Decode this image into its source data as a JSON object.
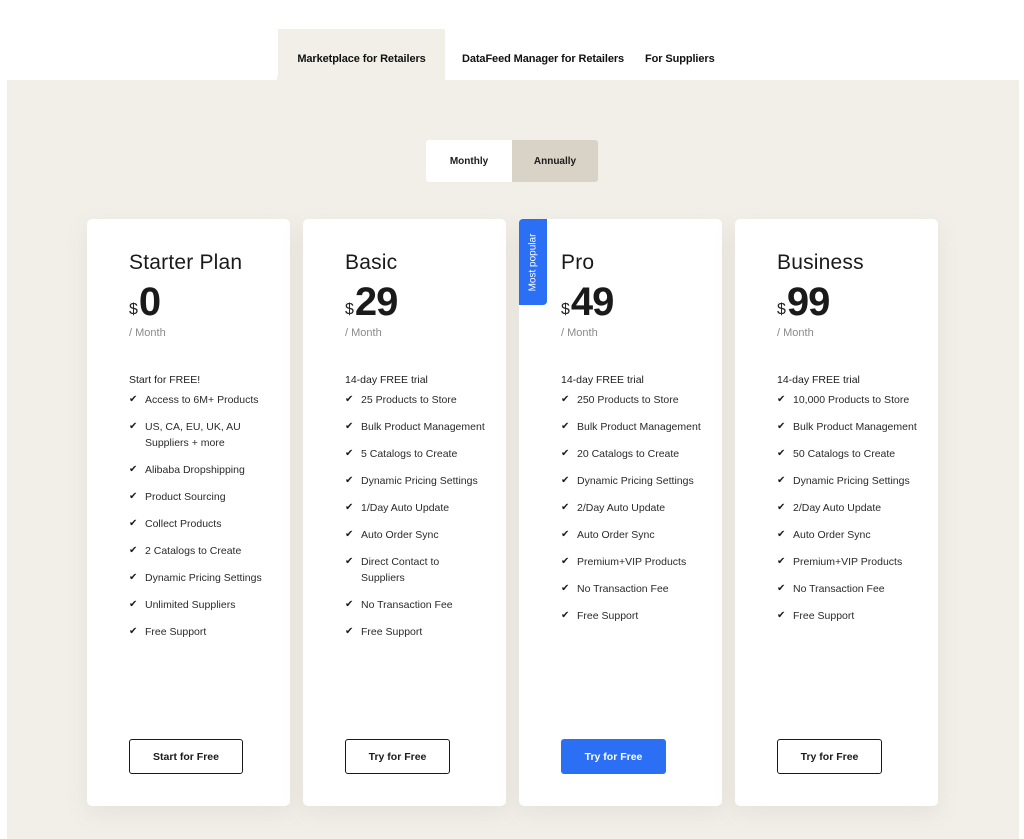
{
  "tabs": [
    {
      "label": "Marketplace for Retailers",
      "active": true
    },
    {
      "label": "DataFeed Manager for Retailers",
      "active": false
    },
    {
      "label": "For Suppliers",
      "active": false
    }
  ],
  "billing_toggle": {
    "options": [
      "Monthly",
      "Annually"
    ],
    "selected": "Annually"
  },
  "colors": {
    "accent": "#2b6ff5",
    "background": "#f2efe9",
    "toggle_selected": "#d9d2c7"
  },
  "plans": [
    {
      "name": "Starter Plan",
      "currency": "$",
      "price": "0",
      "period": "/ Month",
      "intro": "Start for FREE!",
      "features": [
        "Access to 6M+ Products",
        "US, CA, EU, UK, AU Suppliers + more",
        "Alibaba Dropshipping",
        "Product Sourcing",
        "Collect Products",
        "2 Catalogs to Create",
        "Dynamic Pricing Settings",
        "Unlimited Suppliers",
        "Free Support"
      ],
      "cta": "Start for Free"
    },
    {
      "name": "Basic",
      "currency": "$",
      "price": "29",
      "period": "/ Month",
      "intro": "14-day FREE trial",
      "features": [
        "25 Products to Store",
        "Bulk Product Management",
        "5 Catalogs to Create",
        "Dynamic Pricing Settings",
        "1/Day Auto Update",
        "Auto Order Sync",
        "Direct Contact to Suppliers",
        "No Transaction Fee",
        "Free Support"
      ],
      "cta": "Try for Free"
    },
    {
      "name": "Pro",
      "badge": "Most popular",
      "currency": "$",
      "price": "49",
      "period": "/ Month",
      "intro": "14-day FREE trial",
      "features": [
        "250 Products to Store",
        "Bulk Product Management",
        "20 Catalogs to Create",
        "Dynamic Pricing Settings",
        "2/Day Auto Update",
        "Auto Order Sync",
        "Premium+VIP Products",
        "No Transaction Fee",
        "Free Support"
      ],
      "cta": "Try for Free"
    },
    {
      "name": "Business",
      "currency": "$",
      "price": "99",
      "period": "/ Month",
      "intro": "14-day FREE trial",
      "features": [
        "10,000 Products to Store",
        "Bulk Product Management",
        "50 Catalogs to Create",
        "Dynamic Pricing Settings",
        "2/Day Auto Update",
        "Auto Order Sync",
        "Premium+VIP Products",
        "No Transaction Fee",
        "Free Support"
      ],
      "cta": "Try for Free"
    }
  ],
  "icons": {
    "check": "✔"
  }
}
